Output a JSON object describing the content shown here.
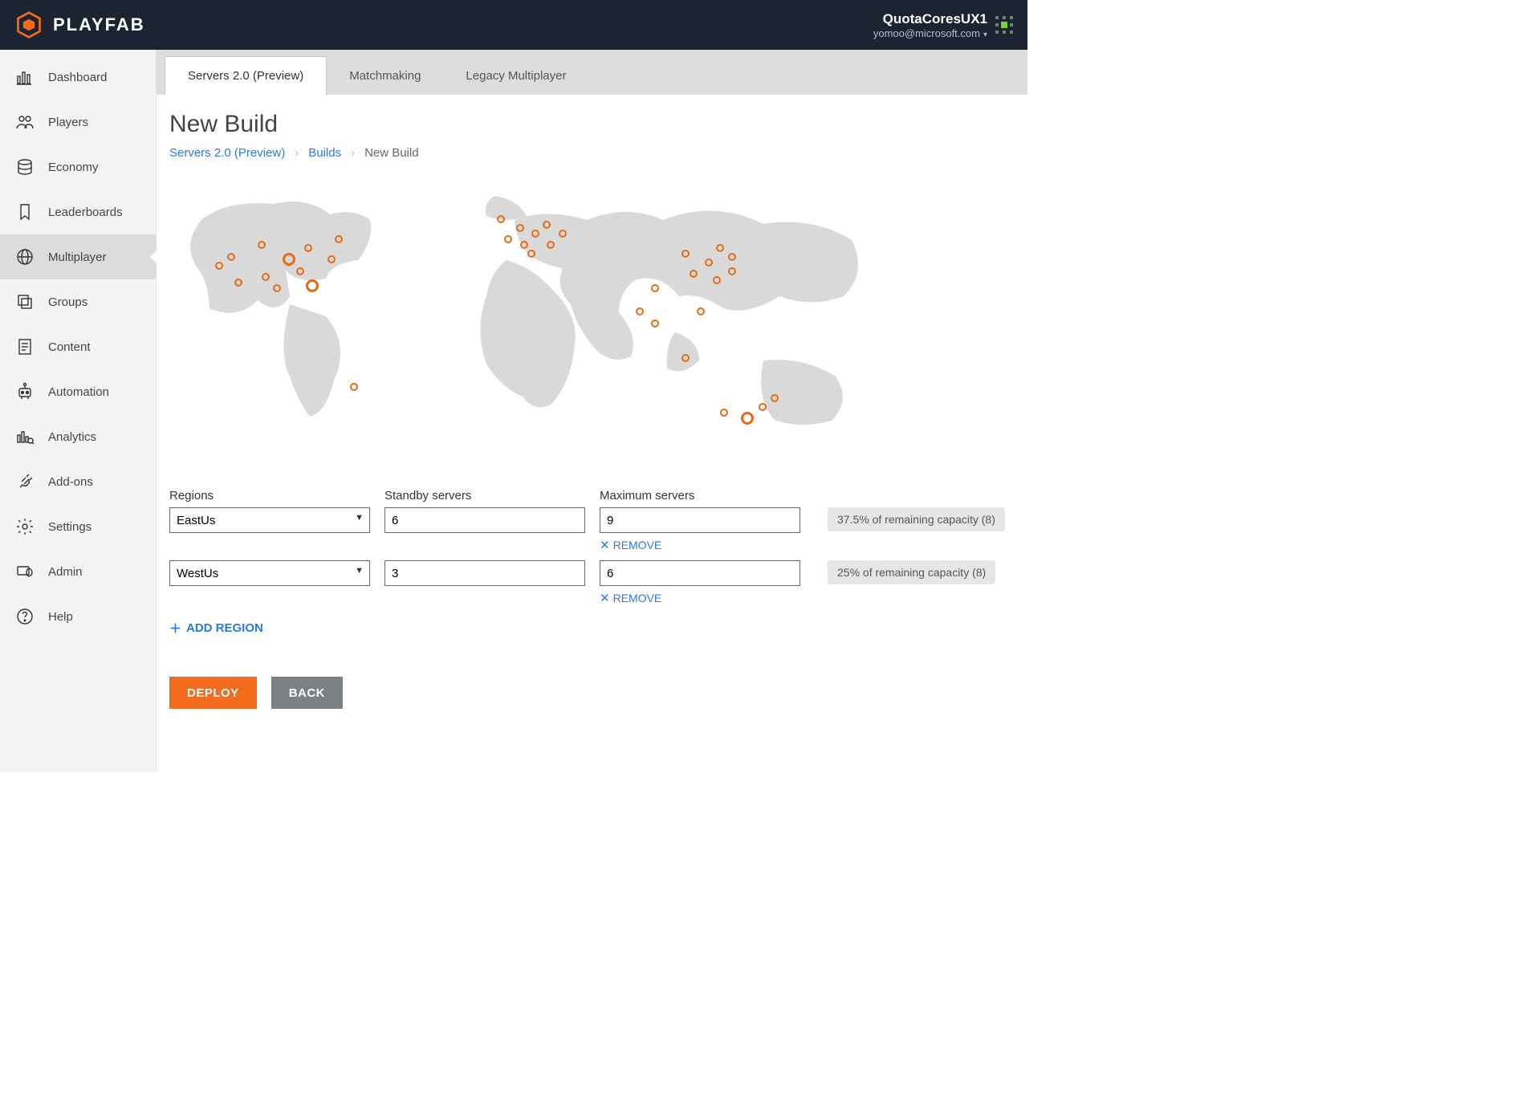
{
  "brand": {
    "name": "PLAYFAB"
  },
  "user": {
    "name": "QuotaCoresUX1",
    "email": "yomoo@microsoft.com"
  },
  "sidebar": {
    "items": [
      {
        "label": "Dashboard"
      },
      {
        "label": "Players"
      },
      {
        "label": "Economy"
      },
      {
        "label": "Leaderboards"
      },
      {
        "label": "Multiplayer"
      },
      {
        "label": "Groups"
      },
      {
        "label": "Content"
      },
      {
        "label": "Automation"
      },
      {
        "label": "Analytics"
      },
      {
        "label": "Add-ons"
      },
      {
        "label": "Settings"
      },
      {
        "label": "Admin"
      },
      {
        "label": "Help"
      }
    ]
  },
  "tabs": [
    {
      "label": "Servers 2.0 (Preview)"
    },
    {
      "label": "Matchmaking"
    },
    {
      "label": "Legacy Multiplayer"
    }
  ],
  "page": {
    "title": "New Build"
  },
  "breadcrumb": {
    "a": "Servers 2.0 (Preview)",
    "b": "Builds",
    "current": "New Build"
  },
  "columns": {
    "regions": "Regions",
    "standby": "Standby servers",
    "maximum": "Maximum servers"
  },
  "rows": [
    {
      "region": "EastUs",
      "standby": "6",
      "maximum": "9",
      "capacity": "37.5% of remaining capacity (8)",
      "remove": "REMOVE"
    },
    {
      "region": "WestUs",
      "standby": "3",
      "maximum": "6",
      "capacity": "25% of remaining capacity (8)",
      "remove": "REMOVE"
    }
  ],
  "actions": {
    "add_region": "ADD REGION",
    "deploy": "DEPLOY",
    "back": "BACK"
  }
}
